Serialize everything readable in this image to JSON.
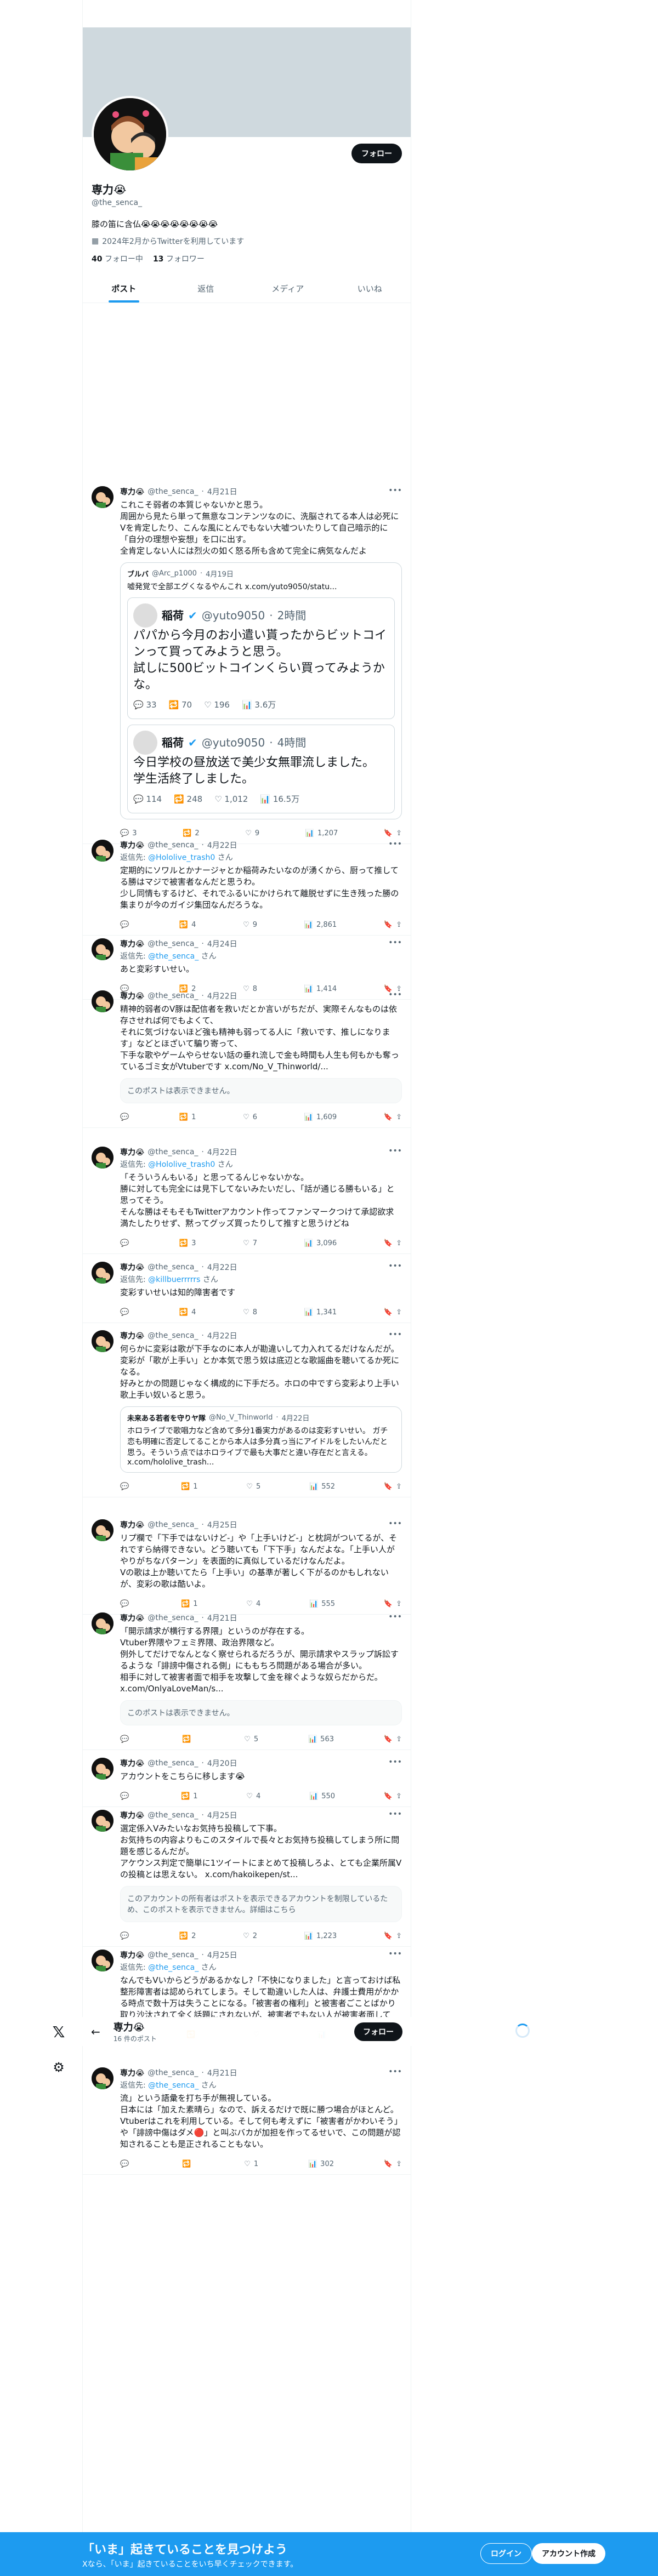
{
  "left_rail": {
    "logo_icon": "x-logo-icon",
    "settings_icon": "gear-icon"
  },
  "profile": {
    "follow_label": "フォロー",
    "name": "専力😭",
    "handle": "@the_senca_",
    "bio": "膝の笛に含仏😭😭😭😭😭😭😭😭",
    "joined": "2024年2月からTwitterを利用しています",
    "following_count": "40",
    "following_label": "フォロー中",
    "followers_count": "13",
    "followers_label": "フォロワー"
  },
  "tabs": [
    {
      "label": "ポスト"
    },
    {
      "label": "返信"
    },
    {
      "label": "メディア"
    },
    {
      "label": "いいね"
    }
  ],
  "tweets": [
    {
      "name": "専力😭",
      "handle": "@the_senca_",
      "date": "4月21日",
      "text": "これこそ弱者の本質じゃないかと思う。\n周囲から見たら単って無意なコンテンツなのに、洗脳されてる本人は必死にVを肯定したり、こんな風にとんでもない大嘘ついたりして自己暗示的に「自分の理想や妄想」を口に出す。\n全肯定しない人には烈火の如く怒る所も含めて完全に病気なんだよ",
      "quote": {
        "name": "ブルバ",
        "handle": "@Arc_p1000",
        "date": "4月19日",
        "text": "嘘発覚で全部エグくなるやんこれ x.com/yuto9050/statu...",
        "shots": [
          {
            "name": "稲荷",
            "handle": "@yuto9050",
            "time": "2時間",
            "text": "パパから今月のお小遣い貰ったからビットコインって買ってみようと思う。\n試しに500ビットコインくらい買ってみようかな。",
            "replies": "33",
            "reposts": "70",
            "likes": "196",
            "views": "3.6万"
          },
          {
            "name": "稲荷",
            "handle": "@yuto9050",
            "time": "4時間",
            "text": "今日学校の昼放送で美少女無罪流しました。\n学生活終了しました。",
            "replies": "114",
            "reposts": "248",
            "likes": "1,012",
            "views": "16.5万"
          }
        ]
      },
      "replies": "3",
      "reposts": "2",
      "likes": "9",
      "views": "1,207"
    },
    {
      "name": "専力😭",
      "handle": "@the_senca_",
      "date": "4月22日",
      "reply_to": "@Hololive_trash0",
      "text": "定期的にソワルとかナージャとか稲荷みたいなのが湧くから、厨って推してる勝はマジで被害者なんだと思うわ。\n少し同情もするけど、それでふるいにかけられて離脱せずに生き残った勝の集まりが今のガイジ集団なんだろうな。",
      "replies": "",
      "reposts": "4",
      "likes": "9",
      "views": "2,861"
    },
    {
      "name": "専力😭",
      "handle": "@the_senca_",
      "date": "4月24日",
      "reply_to": "@the_senca_",
      "text": "あと変彩すいせい。",
      "replies": "",
      "reposts": "2",
      "likes": "8",
      "views": "1,414"
    },
    {
      "name": "専力😭",
      "handle": "@the_senca_",
      "date": "4月22日",
      "text": "精神的弱者のV豚は配信者を救いだとか言いがちだが、実際そんなものは依存させれば何でもよくて、\nそれに気づけないほど強も精神も弱ってる人に「救いです、推しになります」などとほざいて騙り寄って、\n下手な歌やゲームやらせない話の垂れ流しで金も時間も人生も何もかも奪っているゴミ女がVtuberです x.com/No_V_Thinworld/...",
      "unavailable": "このポストは表示できません。",
      "replies": "",
      "reposts": "1",
      "likes": "6",
      "views": "1,609"
    },
    {
      "name": "専力😭",
      "handle": "@the_senca_",
      "date": "4月22日",
      "reply_to": "@Hololive_trash0",
      "text": "「そういうんもいる」と思ってるんじゃないかな。\n勝に対しても完全には見下してないみたいだし、「話が通じる勝もいる」と思ってそう。\nそんな勝はそもそもTwitterアカウント作ってファンマークつけて承認欲求満たしたりせず、黙ってグッズ買ったりして推すと思うけどね",
      "replies": "",
      "reposts": "3",
      "likes": "7",
      "views": "3,096"
    },
    {
      "name": "専力😭",
      "handle": "@the_senca_",
      "date": "4月22日",
      "reply_to": "@killbuerrrrrs",
      "text": "変彩すいせいは知的障害者です",
      "replies": "",
      "reposts": "4",
      "likes": "8",
      "views": "1,341"
    },
    {
      "name": "専力😭",
      "handle": "@the_senca_",
      "date": "4月22日",
      "text": "何らかに変彩は歌が下手なのに本人が勘違いして力入れてるだけなんだが。\n変彩が「歌が上手い」とか本気で思う奴は底辺とな歌謡曲を聴いてるか死になる。\n好みとかの問題じゃなく構成的に下手だろ。ホロの中ですら変彩より上手い歌上手い奴いると思う。",
      "quote": {
        "name": "未来ある若者を守りヤ隊",
        "handle": "@No_V_Thinworld",
        "date": "4月22日",
        "text": "ホロライブで歌唱力など含めて多分1番実力があるのは変彩すいせい。\nガチ恋も明確に否定してることから本人は多分真っ当にアイドルをしたいんだと思う。そういう点ではホロライブで最も大事だと違い存在だと言える。 x.com/hololive_trash..."
      },
      "replies": "",
      "reposts": "1",
      "likes": "5",
      "views": "552"
    },
    {
      "name": "専力😭",
      "handle": "@the_senca_",
      "date": "4月25日",
      "text": "リプ欄で「下手ではないけど-」や「上手いけど-」と枕詞がついてるが、それですら納得できない。どう聴いても「下下手」なんだよな。「上手い人がやりがちなパターン」を表面的に真似しているだけなんだよ。\nVの歌は上か聴いてたら「上手い」の基準が著しく下がるのかもしれないが、変彩の歌は酷いよ。",
      "replies": "",
      "reposts": "1",
      "likes": "4",
      "views": "555"
    },
    {
      "name": "専力😭",
      "handle": "@the_senca_",
      "date": "4月21日",
      "text": "「開示請求が横行する界隈」というのが存在する。\nVtuber界隈やフェミ界隈、政治界隈など。\n例外してだけでなんとなく察せられるだろうが、開示請求やスラップ訴訟するような「誹謗中傷される側」にももちろ問題がある場合が多い。\n相手に対して被害者面で相手を攻撃して金を稼ぐような奴らだからだ。 x.com/OnlyaLoveMan/s...",
      "unavailable": "このポストは表示できません。",
      "replies": "",
      "reposts": "",
      "likes": "5",
      "views": "563"
    },
    {
      "name": "専力😭",
      "handle": "@the_senca_",
      "date": "4月20日",
      "text": "アカウントをこちらに移します😭",
      "replies": "",
      "reposts": "1",
      "likes": "4",
      "views": "550"
    },
    {
      "name": "専力😭",
      "handle": "@the_senca_",
      "date": "4月25日",
      "text": "選定係入Vみたいなお気持ち投稿して下事。\nお気持ちの内容よりもこのスタイルで長々とお気持ち投稿してしまう所に問題を感じるんだが。\nアケウンス判定で簡単に1ツイートにまとめて投稿しろよ、とても企業所属Vの投稿とは思えない。 x.com/hakoikepen/st...",
      "unavailable": "このアカウントの所有者はポストを表示できるアカウントを制限しているため、このポストを表示できません。詳細はこちら",
      "replies": "",
      "reposts": "2",
      "likes": "2",
      "views": "1,223"
    },
    {
      "name": "専力😭",
      "handle": "@the_senca_",
      "date": "4月25日",
      "reply_to": "@the_senca_",
      "text": "なんでもVいからどうがあるかなし?「不快になりました」と言っておけば私整形障害者は認められてしまう。そして勘違いした人は、弁護士費用がかかる時点で数十万は失うことになる。「被害者の権利」と被害者ごことばかり取り沙汰されて全く話題にされないが、被害者でもない人が被害者面して",
      "replies": "",
      "reposts": "",
      "likes": "",
      "views": ""
    },
    {
      "name": "専力😭",
      "handle": "@the_senca_",
      "date": "4月21日",
      "reply_to": "@the_senca_",
      "text": "流」という語彙を打ち手が無視している。\n日本には「加えた素晴ら」なので、訴えるだけで既に勝つ場合がほとんど。\nVtuberはこれを利用している。そして何も考えずに「被害者がかわいそう」や「誹謗中傷はダメ🔴」と叫ぶバカが加担を作ってるせいで、この問題が認知されることも是正されることもない。",
      "replies": "",
      "reposts": "",
      "likes": "1",
      "views": "302"
    }
  ],
  "sticky_header": {
    "name": "専力😭",
    "count": "16 件のポスト",
    "follow_label": "フォロー"
  },
  "bottom_bar": {
    "title": "「いま」起きていることを見つけよう",
    "subtitle": "Xなら、「いま」起きていることをいち早くチェックできます。",
    "login_label": "ログイン",
    "signup_label": "アカウント作成"
  },
  "colors": {
    "accent": "#1d9bf0",
    "text": "#0f1419",
    "muted": "#536471",
    "banner": "#cfd9de"
  }
}
